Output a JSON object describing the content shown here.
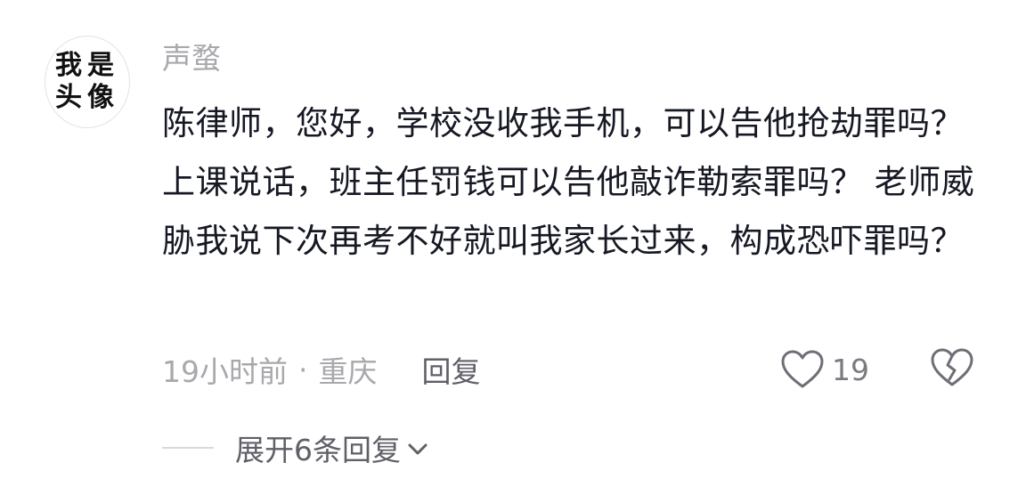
{
  "comment": {
    "avatar_text": "我是头像",
    "username": "声蝥",
    "content": "陈律师，您好，学校没收我手机，可以告他抢劫罪吗？ 上课说话，班主任罚钱可以告他敲诈勒索罪吗？ 老师威胁我说下次再考不好就叫我家长过来，构成恐吓罪吗？",
    "time": "19小时前",
    "separator": "·",
    "location": "重庆",
    "reply_label": "回复",
    "like_count": "19",
    "expand_label": "展开6条回复"
  },
  "icons": {
    "like": "heart-outline-icon",
    "dislike": "broken-heart-icon",
    "expand": "chevron-down-icon"
  },
  "colors": {
    "text_primary": "#161823",
    "text_secondary": "#a8a8ad",
    "text_action": "#5f6068",
    "icon": "#6e6f76"
  }
}
